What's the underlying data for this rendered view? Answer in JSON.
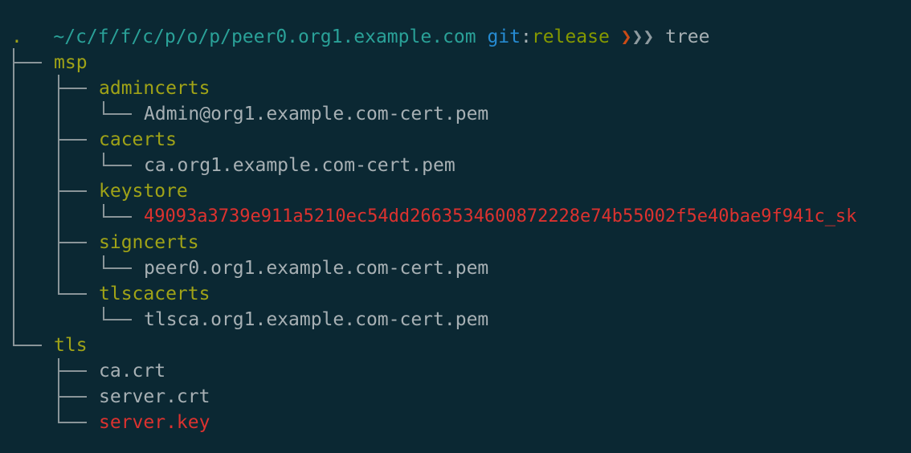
{
  "prompt": {
    "path": "~/c/f/f/c/p/o/p/peer0.org1.example.com",
    "git_label": "git",
    "colon": ":",
    "branch": "release",
    "arrow1": "❯",
    "arrow2": "❯",
    "arrow3": "❯",
    "command": "tree"
  },
  "tree": {
    "root": ".",
    "msp": "msp",
    "admincerts": "admincerts",
    "admin_cert": "Admin@org1.example.com-cert.pem",
    "cacerts": "cacerts",
    "ca_cert": "ca.org1.example.com-cert.pem",
    "keystore": "keystore",
    "sk_file": "49093a3739e911a5210ec54dd2663534600872228e74b55002f5e40bae9f941c_sk",
    "signcerts": "signcerts",
    "peer_cert": "peer0.org1.example.com-cert.pem",
    "tlscacerts": "tlscacerts",
    "tlsca_cert": "tlsca.org1.example.com-cert.pem",
    "tls": "tls",
    "ca_crt": "ca.crt",
    "server_crt": "server.crt",
    "server_key": "server.key"
  },
  "colors": {
    "background": "#0b2833",
    "directory": "#a0a317",
    "file": "#a7b0b4",
    "key_file": "#dc322f",
    "path": "#2aa198",
    "git": "#268bd2"
  }
}
